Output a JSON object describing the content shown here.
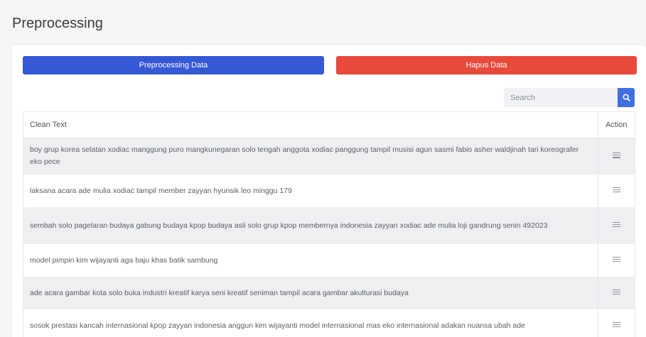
{
  "page": {
    "title": "Preprocessing"
  },
  "toolbar": {
    "preprocess_label": "Preprocessing Data",
    "delete_label": "Hapus Data",
    "primary_color": "#3558d4",
    "danger_color": "#e74a3b"
  },
  "search": {
    "placeholder": "Search",
    "value": "",
    "icon": "search-icon"
  },
  "table": {
    "headers": [
      "Clean Text",
      "Action"
    ],
    "action_icon": "menu-icon",
    "rows": [
      {
        "text": "boy grup korea selatan xodiac manggung puro mangkunegaran solo tengah anggota xodiac panggung tampil musisi agun sasmi fabio asher waldjinah tari koreografer eko pece"
      },
      {
        "text": "laksana acara ade mulia xodiac tampil member zayyan hyunsik leo minggu 179"
      },
      {
        "text": "sembah solo pagelaran budaya gabung budaya kpop budaya asli solo grup kpop membernya indonesia zayyan xodiac ade mulia loji gandrung senin 492023"
      },
      {
        "text": "model pimpin kim wijayanti aga baju khas batik sambung"
      },
      {
        "text": "ade acara gambar kota solo buka industri kreatif karya seni kreatif seniman tampil acara gambar akulturasi budaya"
      },
      {
        "text": "sosok prestasi kancah internasional kpop zayyan indonesia anggun kim wijayanti model internasional mas eko internasional adakan nuansa ubah ade"
      }
    ]
  }
}
